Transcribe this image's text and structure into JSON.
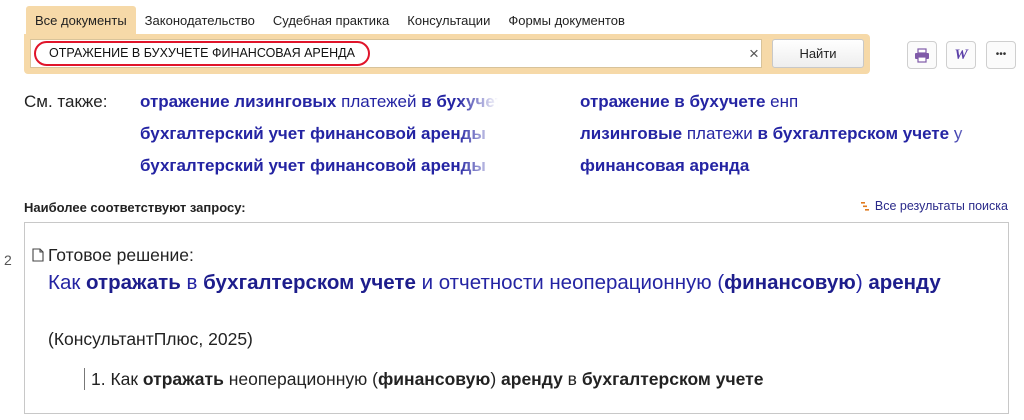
{
  "tabs": [
    {
      "label": "Все документы",
      "active": true
    },
    {
      "label": "Законодательство"
    },
    {
      "label": "Судебная практика"
    },
    {
      "label": "Консультации"
    },
    {
      "label": "Формы документов"
    }
  ],
  "search": {
    "value": "ОТРАЖЕНИЕ В БУХУЧЕТЕ ФИНАНСОВАЯ АРЕНДА",
    "clear_icon": "×",
    "button_label": "Найти"
  },
  "toolbar": {
    "print_icon": "print-icon",
    "word_icon": "W",
    "more_icon": "•••"
  },
  "see_also": {
    "label": "См. также:",
    "links": [
      [
        {
          "t": "отражение лизинговых",
          "b": true
        },
        {
          "t": " платежей ",
          "b": false
        },
        {
          "t": "в бухучете",
          "b": true
        }
      ],
      [
        {
          "t": "отражение в бухучете",
          "b": true
        },
        {
          "t": " енп",
          "b": false
        }
      ],
      [
        {
          "t": "бухгалтерский учет финансовой аренды",
          "b": true
        }
      ],
      [
        {
          "t": "лизинговые",
          "b": true
        },
        {
          "t": " платежи ",
          "b": false
        },
        {
          "t": "в бухгалтерском учете",
          "b": true
        },
        {
          "t": " у",
          "b": false
        }
      ],
      [
        {
          "t": "бухгалтерский учет финансовой аренды",
          "b": true
        }
      ],
      [
        {
          "t": "финансовая аренда",
          "b": true
        }
      ]
    ]
  },
  "results": {
    "heading": "Наиболее соответствуют запросу:",
    "all_results_label": "Все результаты поиска",
    "items": [
      {
        "number": "2",
        "type": "Готовое решение:",
        "title": [
          {
            "t": "Как ",
            "b": false
          },
          {
            "t": "отражать",
            "b": true
          },
          {
            "t": " в ",
            "b": false
          },
          {
            "t": "бухгалтерском учете",
            "b": true
          },
          {
            "t": " и отчетности неоперационную (",
            "b": false
          },
          {
            "t": "финансовую",
            "b": true
          },
          {
            "t": ") ",
            "b": false
          },
          {
            "t": "аренду",
            "b": true
          }
        ],
        "source": "(КонсультантПлюс, 2025)",
        "subitem": [
          {
            "t": "1. Как ",
            "b": false
          },
          {
            "t": "отражать",
            "b": true
          },
          {
            "t": " неоперационную (",
            "b": false
          },
          {
            "t": "финансовую",
            "b": true
          },
          {
            "t": ") ",
            "b": false
          },
          {
            "t": "аренду",
            "b": true
          },
          {
            "t": " в ",
            "b": false
          },
          {
            "t": "бухгалтерском учете",
            "b": true
          }
        ]
      }
    ]
  }
}
